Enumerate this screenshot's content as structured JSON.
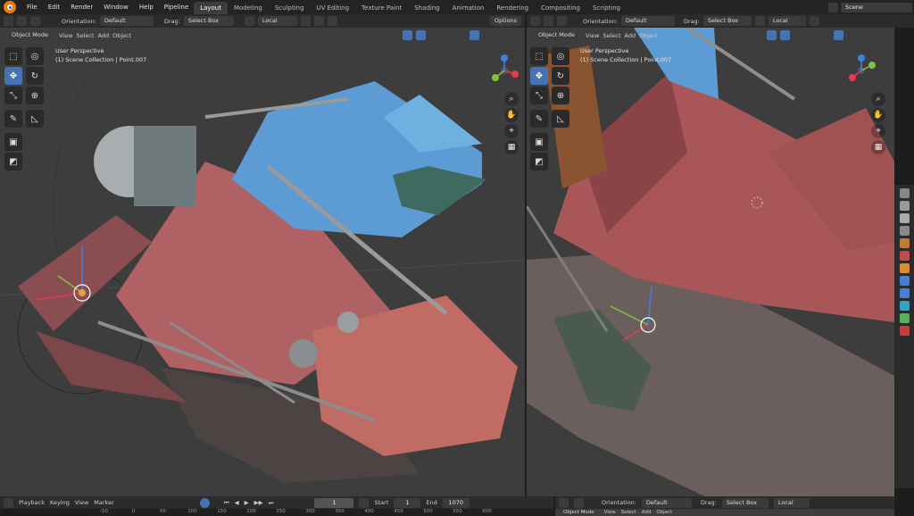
{
  "topbar": {
    "menus": [
      "File",
      "Edit",
      "Render",
      "Window",
      "Help",
      "Pipeline"
    ],
    "workspaces": [
      "Layout",
      "Modeling",
      "Sculpting",
      "UV Editing",
      "Texture Paint",
      "Shading",
      "Animation",
      "Rendering",
      "Compositing",
      "Scripting"
    ],
    "active_workspace": "Layout",
    "scene": "Scene"
  },
  "left_header": {
    "orientation_label": "Orientation:",
    "orientation_value": "Default",
    "drag_label": "Drag:",
    "drag_value": "Select Box",
    "transform_value": "Local",
    "options": "Options"
  },
  "left_viewport": {
    "mode": "Object Mode",
    "menus": [
      "View",
      "Select",
      "Add",
      "Object"
    ],
    "perspective": "User Perspective",
    "collection": "(1) Scene Collection | Point.007"
  },
  "right_header": {
    "orientation_label": "Orientation:",
    "orientation_value": "Default",
    "drag_label": "Drag:",
    "drag_value": "Select Box",
    "transform_value": "Local"
  },
  "right_viewport": {
    "mode": "Object Mode",
    "menus": [
      "View",
      "Select",
      "Add",
      "Object"
    ],
    "perspective": "User Perspective",
    "collection": "(1) Scene Collection | Point.007"
  },
  "timeline": {
    "menus": [
      "Playback",
      "Keying",
      "View",
      "Marker"
    ],
    "current_frame": "1",
    "start_label": "Start",
    "start": "1",
    "end_label": "End",
    "end": "1070",
    "ruler": [
      "-50",
      "0",
      "50",
      "100",
      "150",
      "200",
      "250",
      "300",
      "350",
      "400",
      "450",
      "500",
      "550",
      "600"
    ]
  },
  "bottom_right_header": {
    "orientation_label": "Orientation:",
    "orientation_value": "Default",
    "drag_label": "Drag:",
    "drag_value": "Select Box",
    "transform_value": "Local",
    "mode": "Object Mode",
    "menus": [
      "View",
      "Select",
      "Add",
      "Object"
    ]
  },
  "colors": {
    "accent": "#4772b3",
    "logo": "#e87d0d",
    "axis_x": "#e53950",
    "axis_y": "#7fc33a",
    "axis_z": "#3a84e5"
  }
}
